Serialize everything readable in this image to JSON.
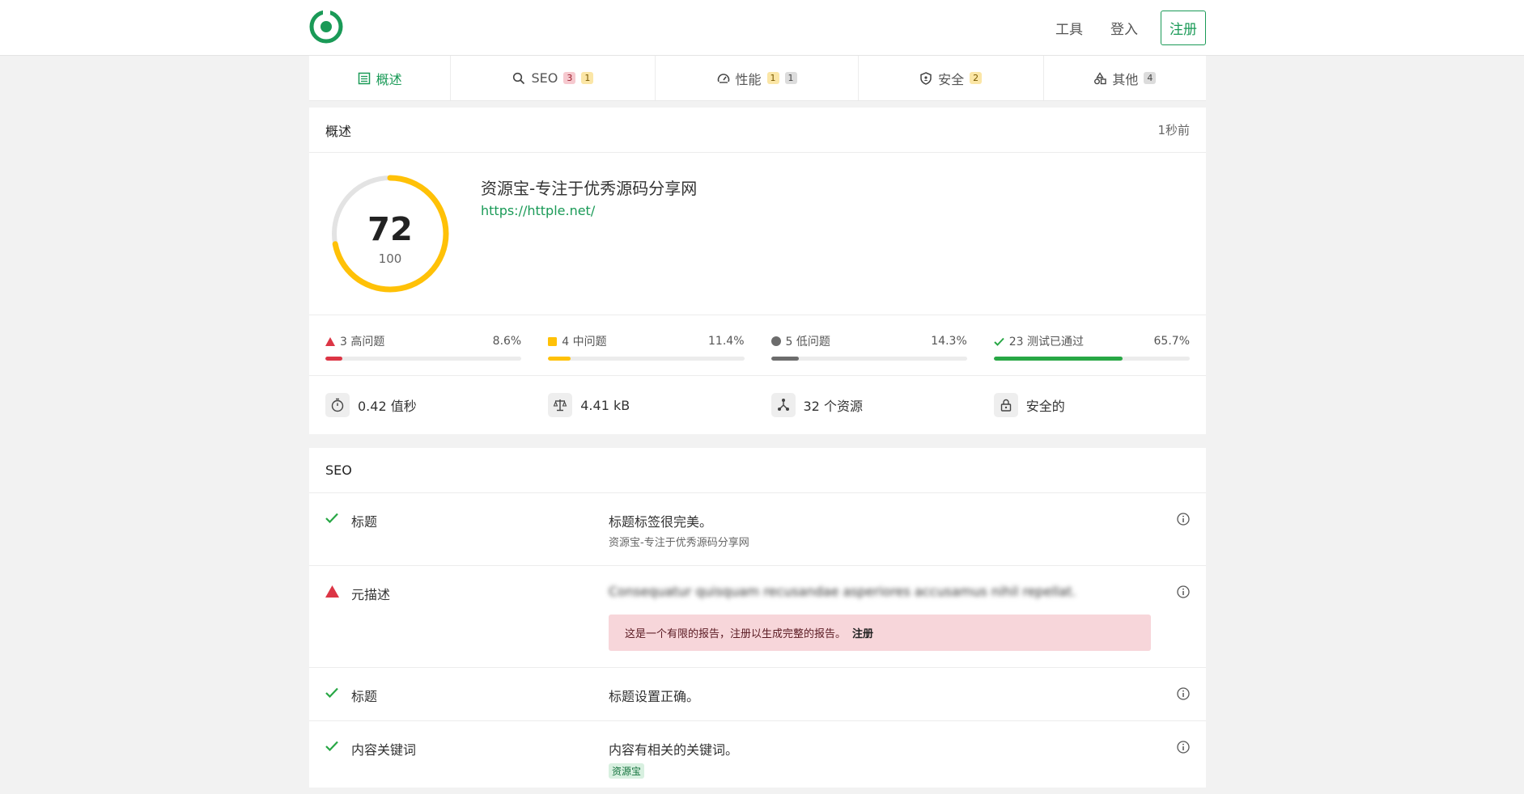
{
  "nav": {
    "tools": "工具",
    "login": "登入",
    "register": "注册"
  },
  "tabs": [
    {
      "label": "概述",
      "icon": "list-icon",
      "badges": []
    },
    {
      "label": "SEO",
      "icon": "search-icon",
      "badges": [
        "3",
        "1"
      ]
    },
    {
      "label": "性能",
      "icon": "speedometer-icon",
      "badges": [
        "1",
        "1"
      ]
    },
    {
      "label": "安全",
      "icon": "shield-icon",
      "badges": [
        "2"
      ]
    },
    {
      "label": "其他",
      "icon": "shapes-icon",
      "badges": [
        "4"
      ]
    }
  ],
  "overview": {
    "title": "概述",
    "time": "1秒前",
    "score": "72",
    "score_max": "100",
    "score_fraction": 0.72,
    "site_title": "资源宝-专注于优秀源码分享网",
    "site_url": "https://httple.net/"
  },
  "issues": [
    {
      "label": "3 高问题",
      "percent": "8.6%",
      "value": 8.6,
      "color": "#dc3545"
    },
    {
      "label": "4 中问题",
      "percent": "11.4%",
      "value": 11.4,
      "color": "#ffc107"
    },
    {
      "label": "5 低问题",
      "percent": "14.3%",
      "value": 14.3,
      "color": "#6c6c6c"
    },
    {
      "label": "23 测试已通过",
      "percent": "65.7%",
      "value": 65.7,
      "color": "#28a745"
    }
  ],
  "stats": [
    {
      "label": "0.42 值秒",
      "icon": "stopwatch-icon"
    },
    {
      "label": "4.41 kB",
      "icon": "scale-icon"
    },
    {
      "label": "32 个资源",
      "icon": "nodes-icon"
    },
    {
      "label": "安全的",
      "icon": "lock-icon"
    }
  ],
  "seo": {
    "title": "SEO",
    "rows": [
      {
        "name": "标题",
        "status": "pass",
        "desc": "标题标签很完美。",
        "sub": "资源宝-专注于优秀源码分享网"
      },
      {
        "name": "元描述",
        "status": "fail",
        "desc": "Consequatur quisquam recusandae asperiores accusamus nihil repellat.",
        "alert": "这是一个有限的报告，注册以生成完整的报告。",
        "alert_link": "注册"
      },
      {
        "name": "标题",
        "status": "pass",
        "desc": "标题设置正确。"
      },
      {
        "name": "内容关键词",
        "status": "pass",
        "desc": "内容有相关的关键词。",
        "tag": "资源宝"
      }
    ]
  }
}
